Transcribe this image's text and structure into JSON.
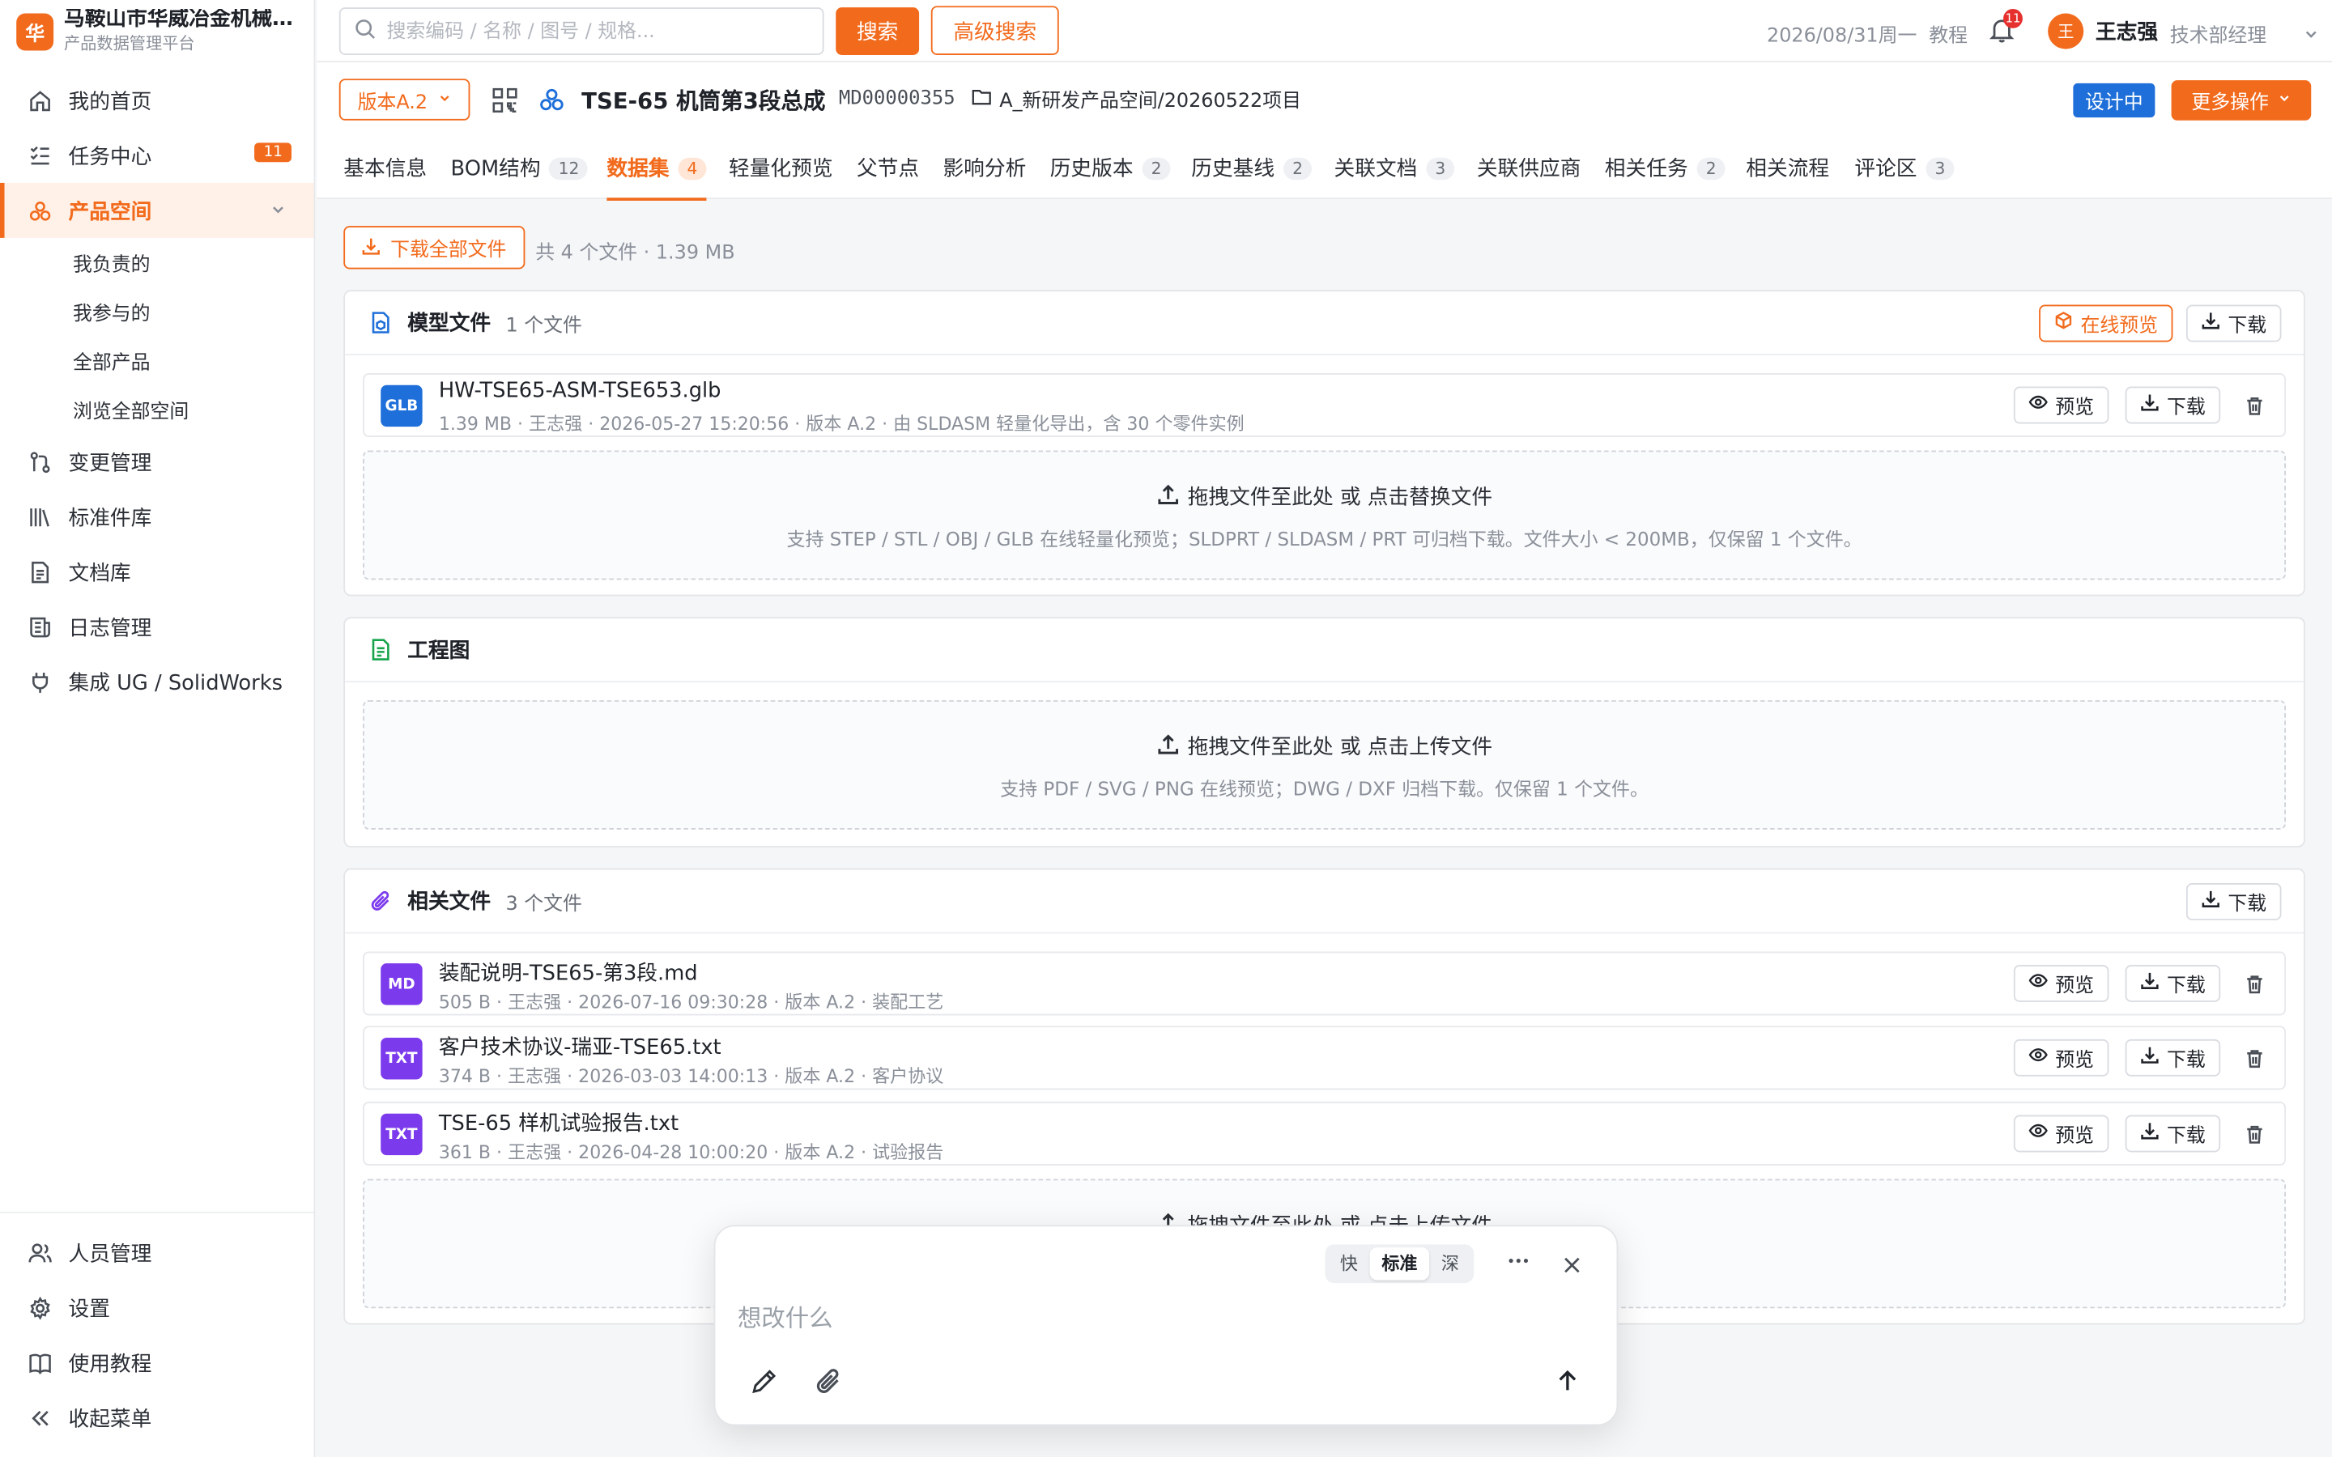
{
  "brand": {
    "logo": "华",
    "title": "马鞍山市华威冶金机械有限公司",
    "subtitle": "产品数据管理平台"
  },
  "sidebar": {
    "items": [
      {
        "label": "我的首页",
        "icon": "home-icon"
      },
      {
        "label": "任务中心",
        "icon": "checklist-icon",
        "badge": "11"
      },
      {
        "label": "产品空间",
        "icon": "product-icon",
        "active": true
      },
      {
        "label": "变更管理",
        "icon": "change-icon"
      },
      {
        "label": "标准件库",
        "icon": "library-icon"
      },
      {
        "label": "文档库",
        "icon": "document-icon"
      },
      {
        "label": "日志管理",
        "icon": "log-icon"
      },
      {
        "label": "集成 UG / SolidWorks",
        "icon": "plug-icon"
      }
    ],
    "subitems": [
      "我负责的",
      "我参与的",
      "全部产品",
      "浏览全部空间"
    ],
    "bottom": [
      {
        "label": "人员管理",
        "icon": "users-icon"
      },
      {
        "label": "设置",
        "icon": "gear-icon"
      },
      {
        "label": "使用教程",
        "icon": "book-icon"
      },
      {
        "label": "收起菜单",
        "icon": "collapse-icon"
      }
    ]
  },
  "header": {
    "search_placeholder": "搜索编码 / 名称 / 图号 / 规格...",
    "search_btn": "搜索",
    "adv_search_btn": "高级搜索",
    "date": "2026/08/31周一",
    "tutorial": "教程",
    "notifications": "11",
    "avatar": "王",
    "user_name": "王志强",
    "user_role": "技术部经理"
  },
  "product": {
    "version": "版本A.2",
    "title": "TSE-65 机筒第3段总成",
    "code": "MD00000355",
    "path": "A_新研发产品空间/20260522项目",
    "status": "设计中",
    "more": "更多操作"
  },
  "tabs": [
    {
      "label": "基本信息"
    },
    {
      "label": "BOM结构",
      "count": "12"
    },
    {
      "label": "数据集",
      "count": "4",
      "active": true
    },
    {
      "label": "轻量化预览"
    },
    {
      "label": "父节点"
    },
    {
      "label": "影响分析"
    },
    {
      "label": "历史版本",
      "count": "2"
    },
    {
      "label": "历史基线",
      "count": "2"
    },
    {
      "label": "关联文档",
      "count": "3"
    },
    {
      "label": "关联供应商"
    },
    {
      "label": "相关任务",
      "count": "2"
    },
    {
      "label": "相关流程"
    },
    {
      "label": "评论区",
      "count": "3"
    }
  ],
  "dataset": {
    "download_all": "下载全部文件",
    "summary": "共 4 个文件 · 1.39 MB",
    "model": {
      "title": "模型文件",
      "count": "1 个文件",
      "preview_online": "在线预览",
      "download": "下载",
      "files": [
        {
          "type": "GLB",
          "name": "HW-TSE65-ASM-TSE653.glb",
          "meta": "1.39 MB · 王志强 · 2026-05-27 15:20:56 · 版本 A.2 · 由 SLDASM 轻量化导出，含 30 个零件实例"
        }
      ],
      "dropzone_main": "拖拽文件至此处 或 点击替换文件",
      "dropzone_sub": "支持 STEP / STL / OBJ / GLB 在线轻量化预览；SLDPRT / SLDASM / PRT 可归档下载。文件大小 < 200MB，仅保留 1 个文件。"
    },
    "drawing": {
      "title": "工程图",
      "dropzone_main": "拖拽文件至此处 或 点击上传文件",
      "dropzone_sub": "支持 PDF / SVG / PNG 在线预览；DWG / DXF 归档下载。仅保留 1 个文件。"
    },
    "related": {
      "title": "相关文件",
      "count": "3 个文件",
      "download": "下载",
      "files": [
        {
          "type": "MD",
          "name": "装配说明-TSE65-第3段.md",
          "meta": "505 B · 王志强 · 2026-07-16 09:30:28 · 版本 A.2 · 装配工艺"
        },
        {
          "type": "TXT",
          "name": "客户技术协议-瑞亚-TSE65.txt",
          "meta": "374 B · 王志强 · 2026-03-03 14:00:13 · 版本 A.2 · 客户协议"
        },
        {
          "type": "TXT",
          "name": "TSE-65 样机试验报告.txt",
          "meta": "361 B · 王志强 · 2026-04-28 10:00:20 · 版本 A.2 · 试验报告"
        }
      ],
      "dropzone_main": "拖拽文件至此处 或 点击上传文件"
    },
    "row_preview": "预览",
    "row_download": "下载"
  },
  "composer": {
    "modes": [
      "快",
      "标准",
      "深"
    ],
    "active_mode": "标准",
    "placeholder": "想改什么"
  },
  "colors": {
    "accent": "#f26b1d",
    "primary_blue": "#1e6fd9",
    "glb": "#1e6fd9",
    "md": "#7c3aed",
    "txt": "#7c3aed"
  }
}
